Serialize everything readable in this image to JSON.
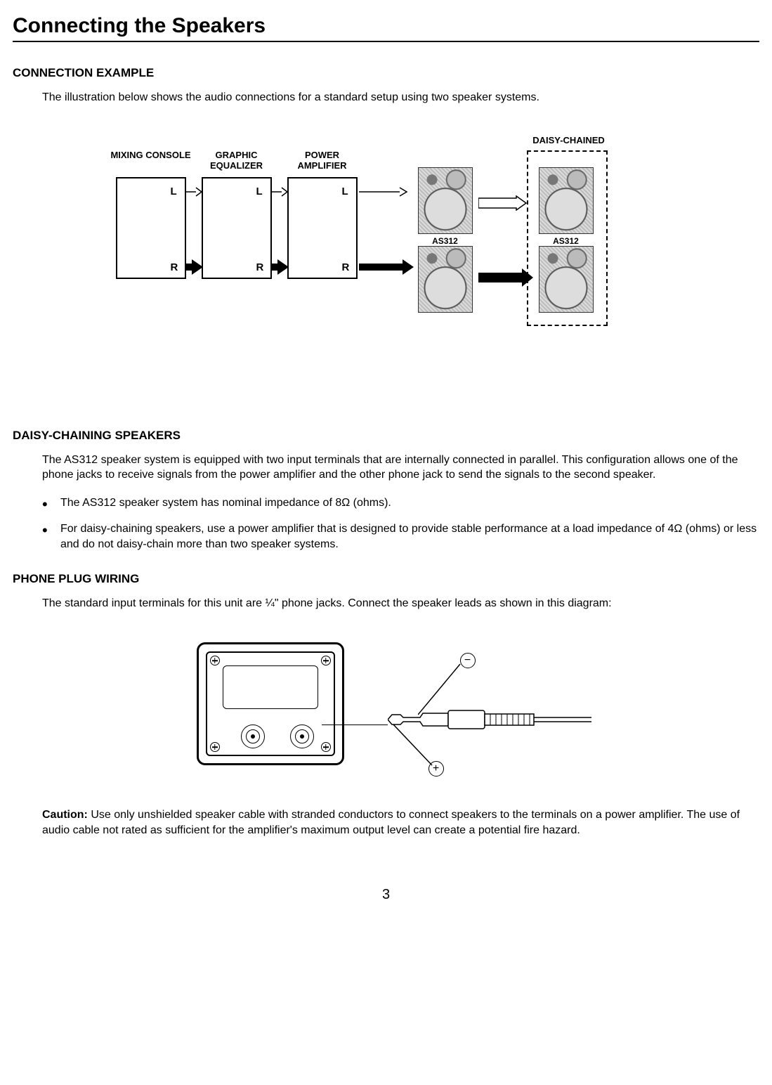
{
  "page": {
    "title": "Connecting the Speakers",
    "number": "3"
  },
  "sections": {
    "conn_example": {
      "heading": "CONNECTION EXAMPLE",
      "intro": "The illustration below shows the audio connections for a standard setup using two speaker systems."
    },
    "daisy": {
      "heading": "DAISY-CHAINING SPEAKERS",
      "para": "The AS312 speaker system is equipped with two input terminals that are internally connected in parallel. This configuration allows one of the phone jacks to receive signals from the power amplifier and the other phone jack to send the signals to the second speaker.",
      "bullets": [
        "The AS312 speaker system has nominal impedance of 8Ω (ohms).",
        "For daisy-chaining speakers, use a power amplifier that is designed to provide stable performance at a load impedance of 4Ω (ohms) or less and do not daisy-chain more than two speaker systems."
      ]
    },
    "plug": {
      "heading": "PHONE PLUG WIRING",
      "para": "The standard input terminals for this unit are ¼\" phone jacks. Connect the speaker leads as shown in this diagram:",
      "caution_label": "Caution:",
      "caution": "  Use only unshielded speaker cable with stranded conductors to connect speakers to the terminals on a power amplifier. The use of audio cable not rated as sufficient for the amplifier's maximum output level can create a potential fire hazard."
    }
  },
  "diagram1": {
    "units": {
      "mixer": "MIXING CONSOLE",
      "eq": "GRAPHIC EQUALIZER",
      "amp": "POWER AMPLIFIER"
    },
    "channels": {
      "left": "L",
      "right": "R"
    },
    "speaker_model": "AS312",
    "daisy_label": "DAISY-CHAINED"
  },
  "diagram2": {
    "minus": "−",
    "plus": "+"
  }
}
